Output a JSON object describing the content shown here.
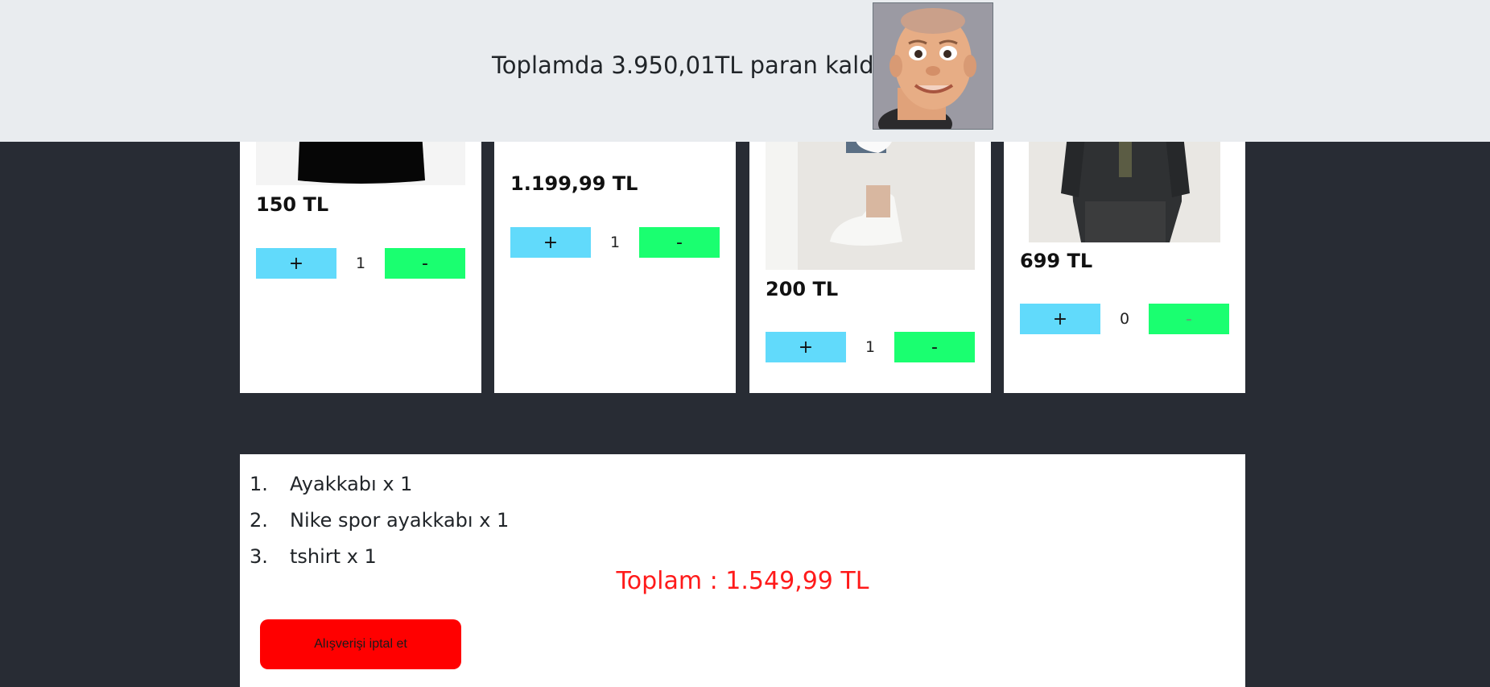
{
  "header": {
    "remaining_text": "Toplamda 3.950,01TL paran kaldı !"
  },
  "products": [
    {
      "price": "150 TL",
      "plus_label": "+",
      "minus_label": "-",
      "quantity": "1"
    },
    {
      "price": "1.199,99 TL",
      "plus_label": "+",
      "minus_label": "-",
      "quantity": "1"
    },
    {
      "price": "200 TL",
      "plus_label": "+",
      "minus_label": "-",
      "quantity": "1"
    },
    {
      "price": "699 TL",
      "plus_label": "+",
      "minus_label": "-",
      "quantity": "0"
    }
  ],
  "basket": {
    "items": [
      {
        "number": "1.",
        "text": "Ayakkabı x 1"
      },
      {
        "number": "2.",
        "text": "Nike spor ayakkabı x 1"
      },
      {
        "number": "3.",
        "text": "tshirt x 1"
      }
    ],
    "total": "Toplam : 1.549,99 TL",
    "cancel_label": "Alışverişi iptal et"
  },
  "colors": {
    "background": "#282c34",
    "header": "#e9ecef",
    "plus_button": "#61dafb",
    "minus_button": "#1aff70",
    "total_text": "#ff1a1a",
    "cancel_button": "#ff0000"
  }
}
